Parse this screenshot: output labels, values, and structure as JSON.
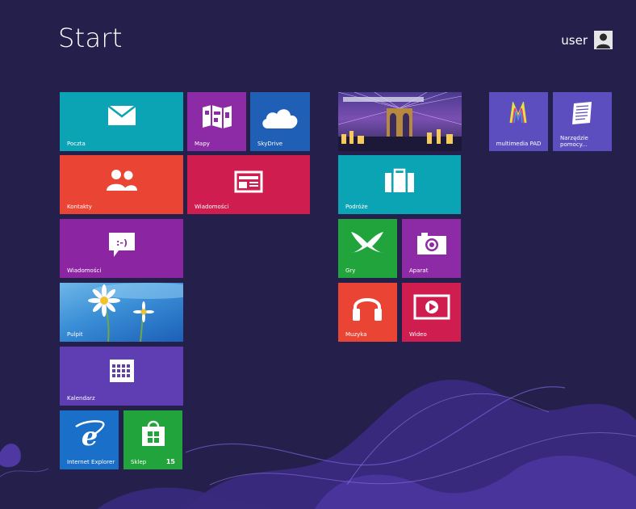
{
  "start_screen": {
    "title": "Start",
    "user": {
      "name": "user"
    }
  },
  "tiles": {
    "mail": {
      "label": "Poczta",
      "icon": "mail-icon"
    },
    "maps": {
      "label": "Mapy",
      "icon": "map-icon"
    },
    "skydrive": {
      "label": "SkyDrive",
      "icon": "cloud-icon"
    },
    "photo_live": {
      "label": "",
      "icon": "bridge-photo"
    },
    "multimedia": {
      "label": "multimedia PAD",
      "icon": "multimedia-logo-icon"
    },
    "tools": {
      "label": "Narzędzie pomocy...",
      "icon": "document-icon"
    },
    "people": {
      "label": "Kontakty",
      "icon": "people-icon"
    },
    "news": {
      "label": "Wiadomości",
      "icon": "newspaper-icon"
    },
    "travel": {
      "label": "Podróże",
      "icon": "suitcase-icon"
    },
    "messaging": {
      "label": "Wiadomości",
      "icon": "chat-bubble-icon"
    },
    "games": {
      "label": "Gry",
      "icon": "gamepad-icon"
    },
    "camera": {
      "label": "Aparat",
      "icon": "camera-icon"
    },
    "desktop": {
      "label": "Pulpit",
      "icon": "daisy-wallpaper"
    },
    "music": {
      "label": "Muzyka",
      "icon": "headphones-icon"
    },
    "video": {
      "label": "Wideo",
      "icon": "video-play-icon"
    },
    "calendar": {
      "label": "Kalendarz",
      "icon": "calendar-icon"
    },
    "ie": {
      "label": "Internet Explorer",
      "icon": "ie-logo-icon"
    },
    "store": {
      "label": "Sklep",
      "icon": "store-bag-icon",
      "badge": "15"
    }
  },
  "colors": {
    "background": "#24204b",
    "teal": "#0ba4b4",
    "purple": "#8d2aa5",
    "blue": "#1f5fb5",
    "red": "#ea4534",
    "crimson": "#cf1d4f",
    "indigo": "#5f3eb4",
    "green": "#21a43b"
  }
}
